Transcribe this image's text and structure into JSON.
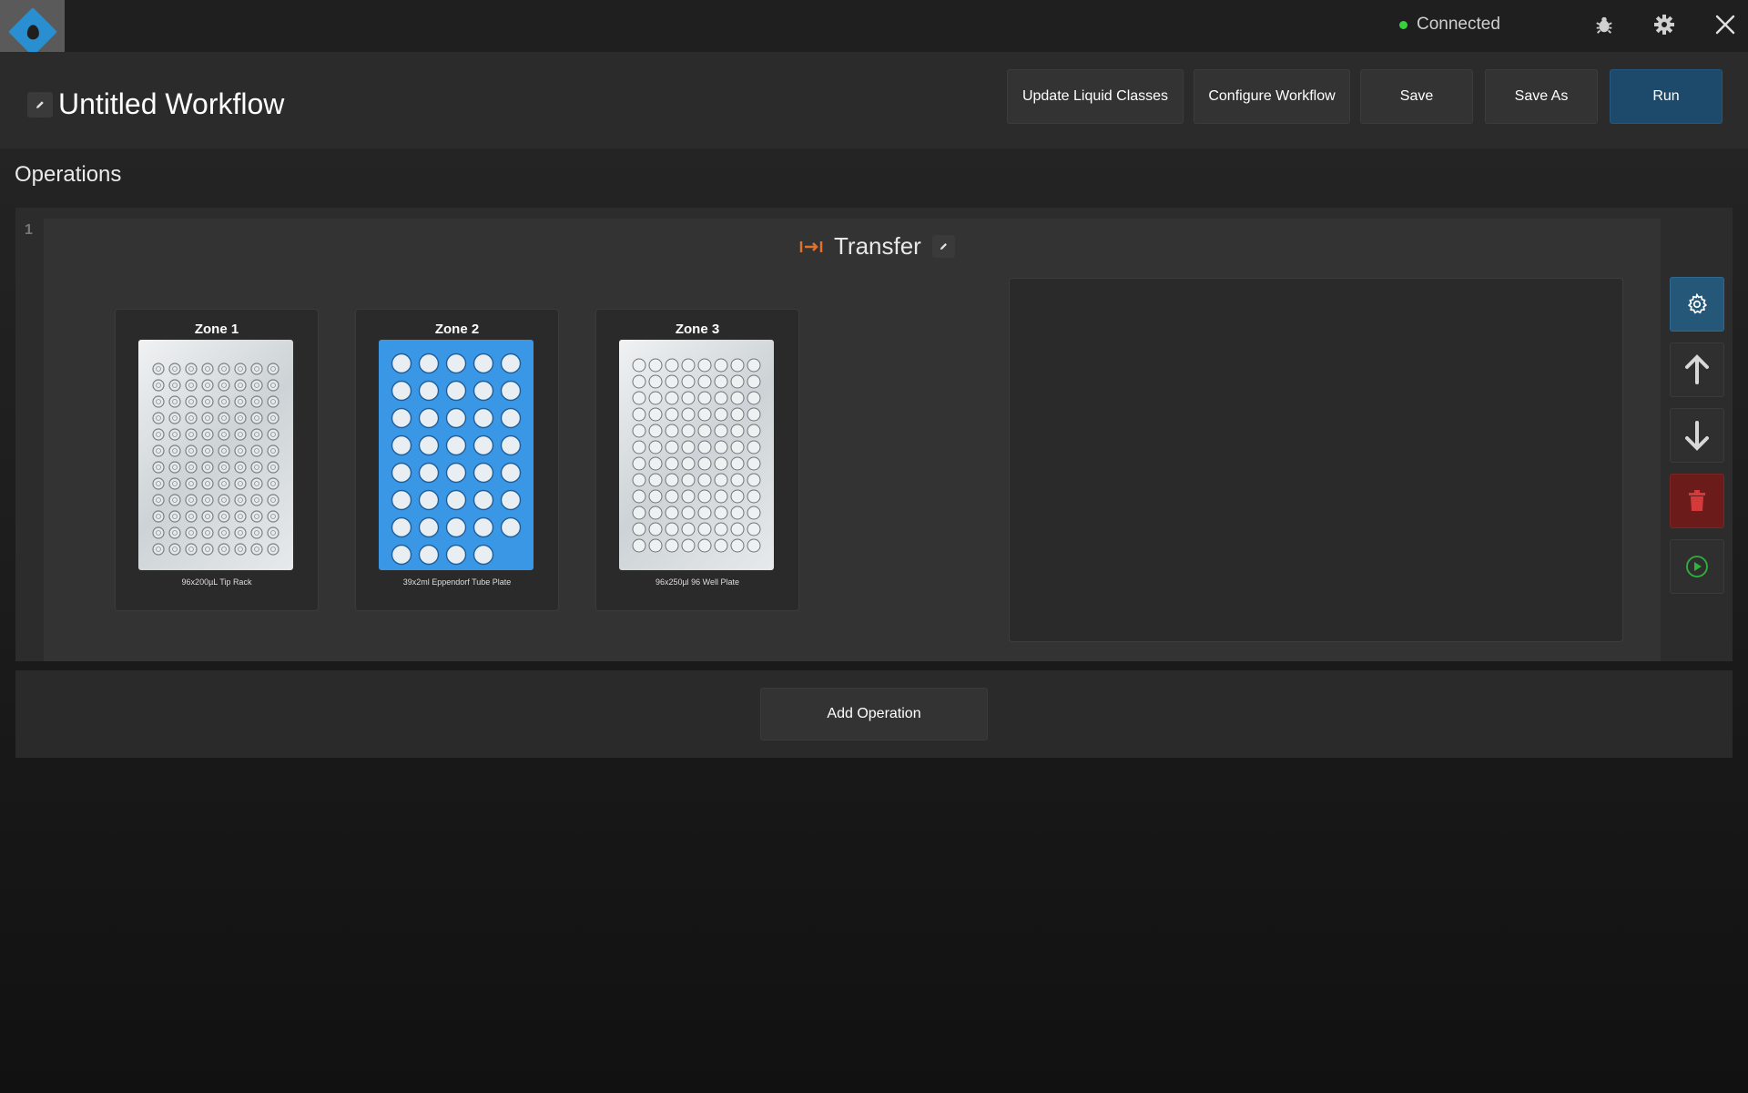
{
  "status": {
    "label": "Connected",
    "color": "#36d13c"
  },
  "workflow": {
    "title": "Untitled Workflow"
  },
  "header_buttons": {
    "update_liquid_classes": "Update Liquid Classes",
    "configure_workflow": "Configure Workflow",
    "save": "Save",
    "save_as": "Save As",
    "run": "Run"
  },
  "operations": {
    "label": "Operations",
    "items": [
      {
        "number": "1",
        "type_icon": "transfer-icon",
        "title": "Transfer",
        "zones": [
          {
            "title": "Zone 1",
            "caption": "96x200µL Tip Rack"
          },
          {
            "title": "Zone 2",
            "caption": "39x2ml Eppendorf Tube Plate"
          },
          {
            "title": "Zone 3",
            "caption": "96x250µl 96 Well Plate"
          }
        ]
      }
    ],
    "add_label": "Add Operation"
  },
  "icons": {
    "top": [
      "bug-icon",
      "gear-icon",
      "close-icon"
    ],
    "side": [
      "gear-icon",
      "arrow-up-icon",
      "arrow-down-icon",
      "trash-icon",
      "play-icon"
    ]
  },
  "colors": {
    "accent": "#2a8fd0",
    "run": "#1d4a6b",
    "danger": "#6c1b1b",
    "transfer_icon": "#e0722a"
  }
}
